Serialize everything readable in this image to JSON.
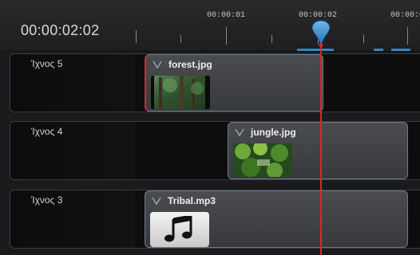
{
  "timeline": {
    "current_time": "00:00:02:02",
    "ruler_labels": [
      {
        "text": "00:00:01",
        "t": 1
      },
      {
        "text": "00:00:02",
        "t": 2
      },
      {
        "text": "00:00:0",
        "t": 3
      }
    ]
  },
  "tracks": [
    {
      "name": "Ίχνος 5",
      "clip": {
        "title": "forest.jpg",
        "thumb_icon": "forest-image"
      }
    },
    {
      "name": "Ίχνος 4",
      "clip": {
        "title": "jungle.jpg",
        "thumb_icon": "jungle-image"
      }
    },
    {
      "name": "Ίχνος 3",
      "clip": {
        "title": "Tribal.mp3",
        "thumb_icon": "music-note-icon"
      }
    }
  ],
  "colors": {
    "playhead": "#d8282b",
    "playhead_handle": "#2f86c9",
    "clip_border": "#6b7c8c"
  }
}
